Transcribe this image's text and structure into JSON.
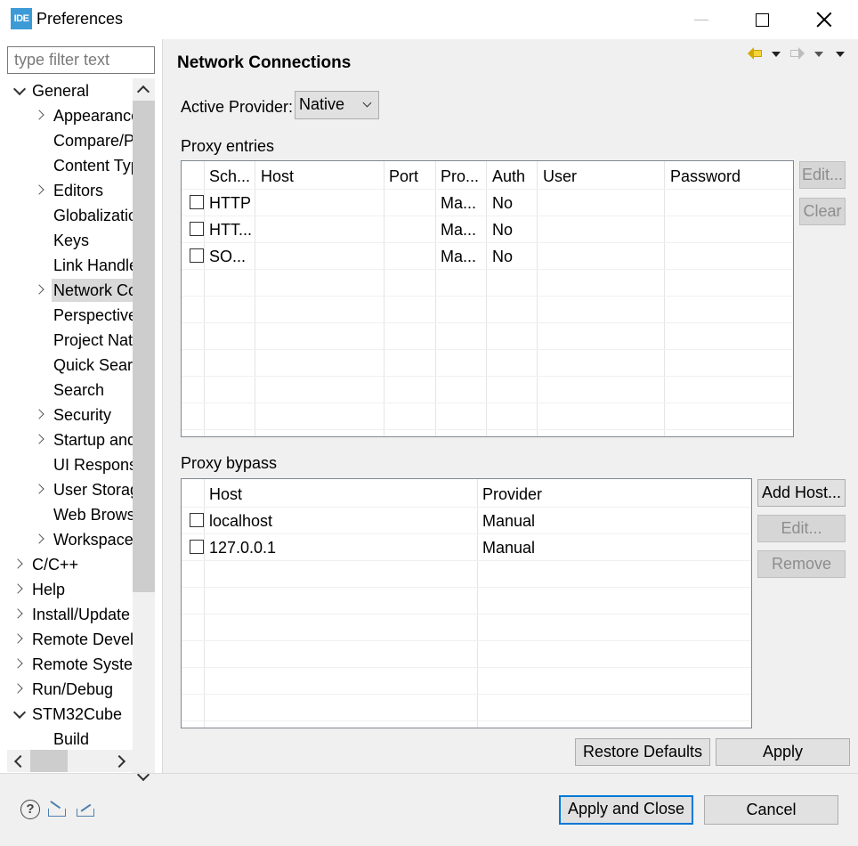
{
  "window": {
    "title": "Preferences",
    "app_icon_text": "IDE"
  },
  "filter": {
    "placeholder": "type filter text",
    "value": ""
  },
  "tree": [
    {
      "label": "General",
      "level": 0,
      "expander": "expanded",
      "selected": false
    },
    {
      "label": "Appearance",
      "level": 1,
      "expander": "collapsed",
      "selected": false
    },
    {
      "label": "Compare/Patch",
      "level": 1,
      "expander": "none",
      "selected": false
    },
    {
      "label": "Content Types",
      "level": 1,
      "expander": "none",
      "selected": false
    },
    {
      "label": "Editors",
      "level": 1,
      "expander": "collapsed",
      "selected": false
    },
    {
      "label": "Globalization",
      "level": 1,
      "expander": "none",
      "selected": false
    },
    {
      "label": "Keys",
      "level": 1,
      "expander": "none",
      "selected": false
    },
    {
      "label": "Link Handlers",
      "level": 1,
      "expander": "none",
      "selected": false
    },
    {
      "label": "Network Connections",
      "level": 1,
      "expander": "collapsed",
      "selected": true
    },
    {
      "label": "Perspectives",
      "level": 1,
      "expander": "none",
      "selected": false
    },
    {
      "label": "Project Natures",
      "level": 1,
      "expander": "none",
      "selected": false
    },
    {
      "label": "Quick Search",
      "level": 1,
      "expander": "none",
      "selected": false
    },
    {
      "label": "Search",
      "level": 1,
      "expander": "none",
      "selected": false
    },
    {
      "label": "Security",
      "level": 1,
      "expander": "collapsed",
      "selected": false
    },
    {
      "label": "Startup and Shutdown",
      "level": 1,
      "expander": "collapsed",
      "selected": false
    },
    {
      "label": "UI Responsiveness",
      "level": 1,
      "expander": "none",
      "selected": false
    },
    {
      "label": "User Storage",
      "level": 1,
      "expander": "collapsed",
      "selected": false
    },
    {
      "label": "Web Browser",
      "level": 1,
      "expander": "none",
      "selected": false
    },
    {
      "label": "Workspace",
      "level": 1,
      "expander": "collapsed",
      "selected": false
    },
    {
      "label": "C/C++",
      "level": 0,
      "expander": "collapsed",
      "selected": false
    },
    {
      "label": "Help",
      "level": 0,
      "expander": "collapsed",
      "selected": false
    },
    {
      "label": "Install/Update",
      "level": 0,
      "expander": "collapsed",
      "selected": false
    },
    {
      "label": "Remote Development",
      "level": 0,
      "expander": "collapsed",
      "selected": false
    },
    {
      "label": "Remote Systems",
      "level": 0,
      "expander": "collapsed",
      "selected": false
    },
    {
      "label": "Run/Debug",
      "level": 0,
      "expander": "collapsed",
      "selected": false
    },
    {
      "label": "STM32Cube",
      "level": 0,
      "expander": "expanded",
      "selected": false
    },
    {
      "label": "Build",
      "level": 1,
      "expander": "none",
      "selected": false
    }
  ],
  "page": {
    "title": "Network Connections",
    "active_provider_label": "Active Provider:",
    "active_provider_value": "Native",
    "proxy_entries_label": "Proxy entries",
    "proxy_bypass_label": "Proxy bypass"
  },
  "proxy_entries": {
    "columns": [
      "Sch...",
      "Host",
      "Port",
      "Pro...",
      "Auth",
      "User",
      "Password"
    ],
    "rows": [
      {
        "checked": false,
        "scheme": "HTTP",
        "host": "",
        "port": "",
        "provider": "Ma...",
        "auth": "No",
        "user": "",
        "password": ""
      },
      {
        "checked": false,
        "scheme": "HTT...",
        "host": "",
        "port": "",
        "provider": "Ma...",
        "auth": "No",
        "user": "",
        "password": ""
      },
      {
        "checked": false,
        "scheme": "SO...",
        "host": "",
        "port": "",
        "provider": "Ma...",
        "auth": "No",
        "user": "",
        "password": ""
      }
    ],
    "buttons": {
      "edit": "Edit...",
      "clear": "Clear"
    }
  },
  "proxy_bypass": {
    "columns": [
      "Host",
      "Provider"
    ],
    "rows": [
      {
        "checked": false,
        "host": "localhost",
        "provider": "Manual"
      },
      {
        "checked": false,
        "host": "127.0.0.1",
        "provider": "Manual"
      }
    ],
    "buttons": {
      "add_host": "Add Host...",
      "edit": "Edit...",
      "remove": "Remove"
    }
  },
  "page_buttons": {
    "restore_defaults": "Restore Defaults",
    "apply": "Apply"
  },
  "dialog_buttons": {
    "apply_and_close": "Apply and Close",
    "cancel": "Cancel"
  },
  "icons": {
    "help": "help-icon",
    "import": "import-icon",
    "export": "export-icon",
    "help_glyph": "?"
  },
  "colors": {
    "selection": "#d9d9d9",
    "default_button_border": "#0078d7",
    "app_icon": "#3c9bd6"
  }
}
